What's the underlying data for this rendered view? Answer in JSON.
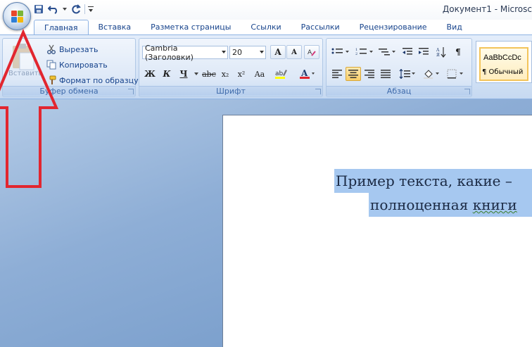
{
  "window": {
    "title": "Документ1 - Microsc"
  },
  "tabs": [
    {
      "label": "Главная",
      "active": true
    },
    {
      "label": "Вставка"
    },
    {
      "label": "Разметка страницы"
    },
    {
      "label": "Ссылки"
    },
    {
      "label": "Рассылки"
    },
    {
      "label": "Рецензирование"
    },
    {
      "label": "Вид"
    }
  ],
  "clipboard": {
    "paste_label": "Вставить",
    "cut_label": "Вырезать",
    "copy_label": "Копировать",
    "format_painter_label": "Формат по образцу",
    "group_label": "Буфер обмена"
  },
  "font": {
    "font_name": "Cambria (Заголовки)",
    "font_size": "20",
    "bold": "Ж",
    "italic": "К",
    "underline": "Ч",
    "strike": "abc",
    "subscript": "x₂",
    "superscript": "x²",
    "change_case": "Aa",
    "grow": "A",
    "shrink": "A",
    "group_label": "Шрифт"
  },
  "paragraph": {
    "pilcrow": "¶",
    "group_label": "Абзац"
  },
  "styles": {
    "sample_text": "AaBbCcDc",
    "normal_label": "¶ Обычный"
  },
  "document": {
    "line1": "Пример текста, какие –",
    "line2_plain": "полноценная ",
    "line2_squiggle": "книги"
  },
  "colors": {
    "annotation_arrow": "#e2262f",
    "selection": "#a6c8f0",
    "ribbon_text": "#15428b"
  }
}
